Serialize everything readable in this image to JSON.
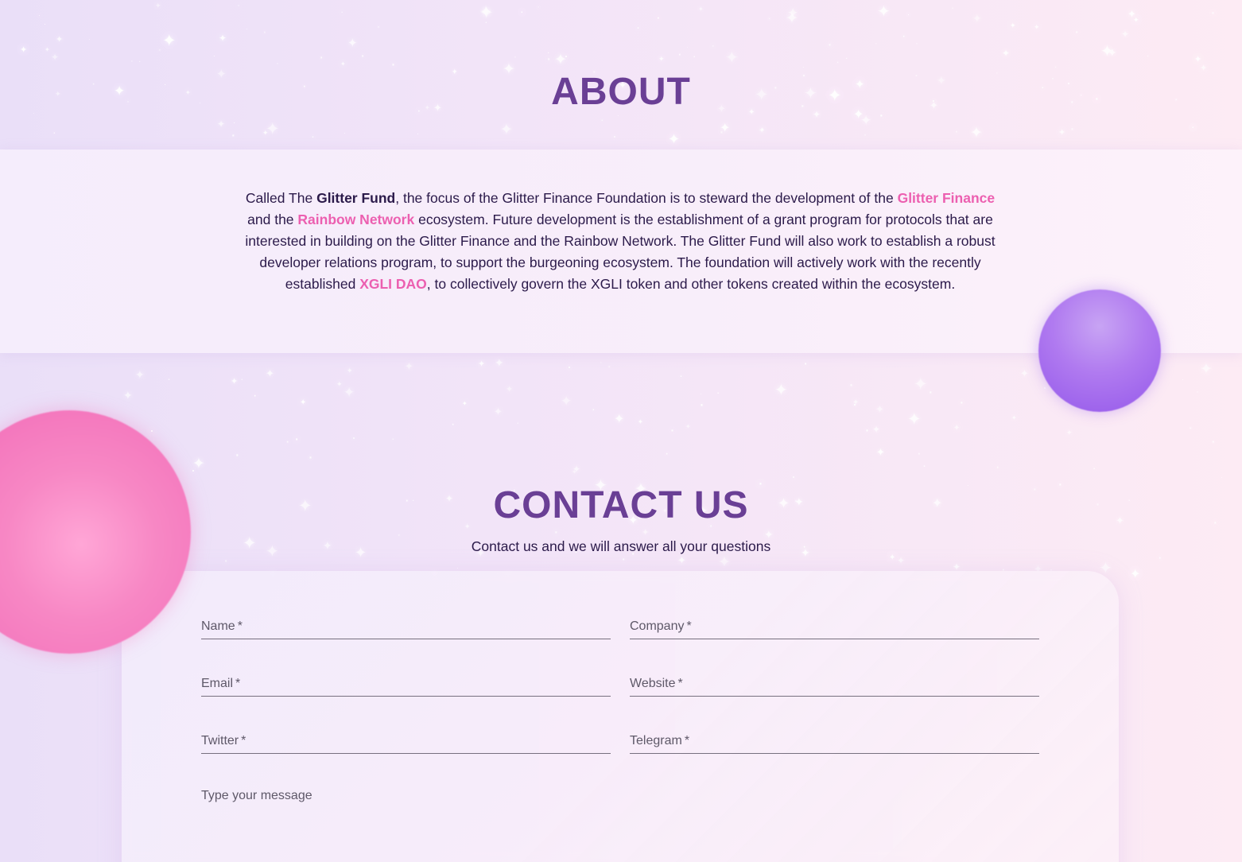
{
  "about": {
    "title": "ABOUT",
    "text": {
      "p1": "Called The ",
      "b1": "Glitter Fund",
      "p2": ", the focus of the Glitter Finance Foundation is to steward the development of the ",
      "link1": "Glitter Finance",
      "p3": " and the ",
      "link2": "Rainbow Network",
      "p4": " ecosystem. Future development is the establishment of a grant program for protocols that are interested in building on the Glitter Finance and the Rainbow Network. The Glitter Fund will also work to establish a robust developer relations program, to support the burgeoning ecosystem. The foundation will actively work with the recently established ",
      "link3": "XGLI DAO",
      "p5": ", to collectively govern the XGLI token and other tokens created within the ecosystem."
    }
  },
  "contact": {
    "title": "CONTACT US",
    "subtitle": "Contact us and we will answer all your questions",
    "fields": {
      "name": "Name",
      "company": "Company",
      "email": "Email",
      "website": "Website",
      "twitter": "Twitter",
      "telegram": "Telegram",
      "required_mark": "*"
    },
    "message_placeholder": "Type your message"
  },
  "colors": {
    "heading": "#6a3f95",
    "link_pink": "#ec5fb0",
    "body_text": "#2b1a4a",
    "orb_pink": "#f16ab7",
    "orb_purple": "#9458ea"
  }
}
